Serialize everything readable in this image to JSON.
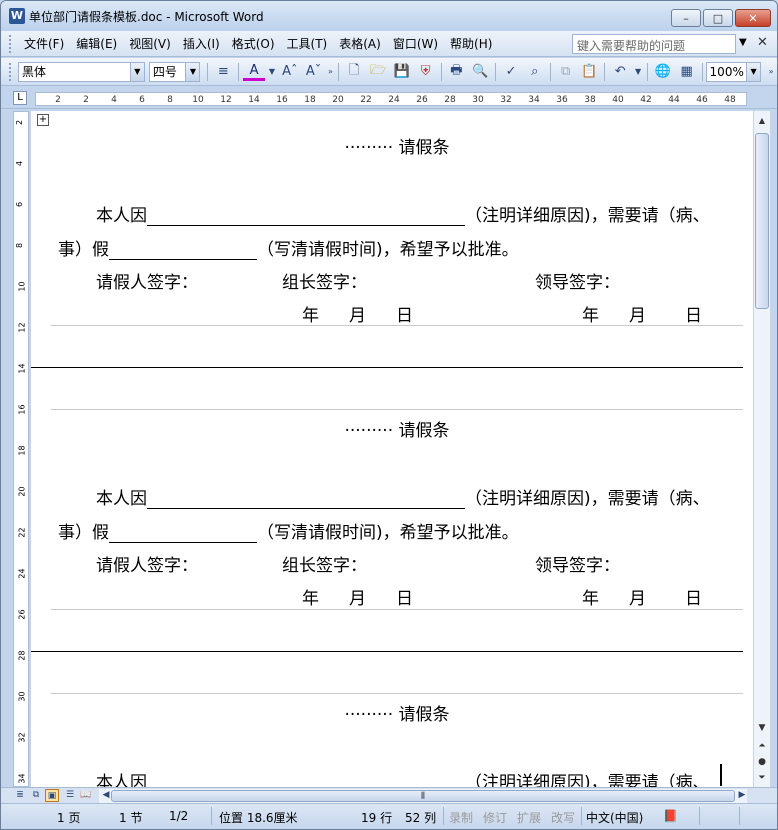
{
  "window": {
    "title": "单位部门请假条模板.doc - Microsoft Word",
    "minimize_glyph": "–",
    "maximize_glyph": "□",
    "close_glyph": "✕"
  },
  "menu": {
    "items": [
      "文件(F)",
      "编辑(E)",
      "视图(V)",
      "插入(I)",
      "格式(O)",
      "工具(T)",
      "表格(A)",
      "窗口(W)",
      "帮助(H)"
    ],
    "help_placeholder": "键入需要帮助的问题"
  },
  "toolbar": {
    "font_name": "黑体",
    "font_size": "四号",
    "zoom": "100%"
  },
  "ruler": {
    "h_ticks": [
      "2",
      "2",
      "4",
      "6",
      "8",
      "10",
      "12",
      "14",
      "16",
      "18",
      "20",
      "22",
      "24",
      "26",
      "28",
      "30",
      "32",
      "34",
      "36",
      "38",
      "40",
      "42",
      "44",
      "46",
      "48"
    ],
    "v_ticks": [
      "2",
      "4",
      "6",
      "8",
      "10",
      "12",
      "14",
      "16",
      "18",
      "20",
      "22",
      "24",
      "26",
      "28",
      "30",
      "32",
      "34"
    ]
  },
  "form": {
    "title": "········· 请假条",
    "reason_prefix": "本人因",
    "reason_suffix": "（注明详细原因)，需要请（病、",
    "line2_prefix": "事）假",
    "line2_suffix": "（写清请假时间)，希望予以批准。",
    "applicant_sign": "请假人签字：",
    "leader_sign": "组长签字：",
    "boss_sign": "领导签字：",
    "year": "年",
    "month": "月",
    "day": "日"
  },
  "status": {
    "page": "1 页",
    "section": "1 节",
    "page_of": "1/2",
    "position": "位置 18.6厘米",
    "line": "19 行",
    "column": "52 列",
    "rec": "录制",
    "trk": "修订",
    "ext": "扩展",
    "ovr": "改写",
    "language": "中文(中国)"
  }
}
